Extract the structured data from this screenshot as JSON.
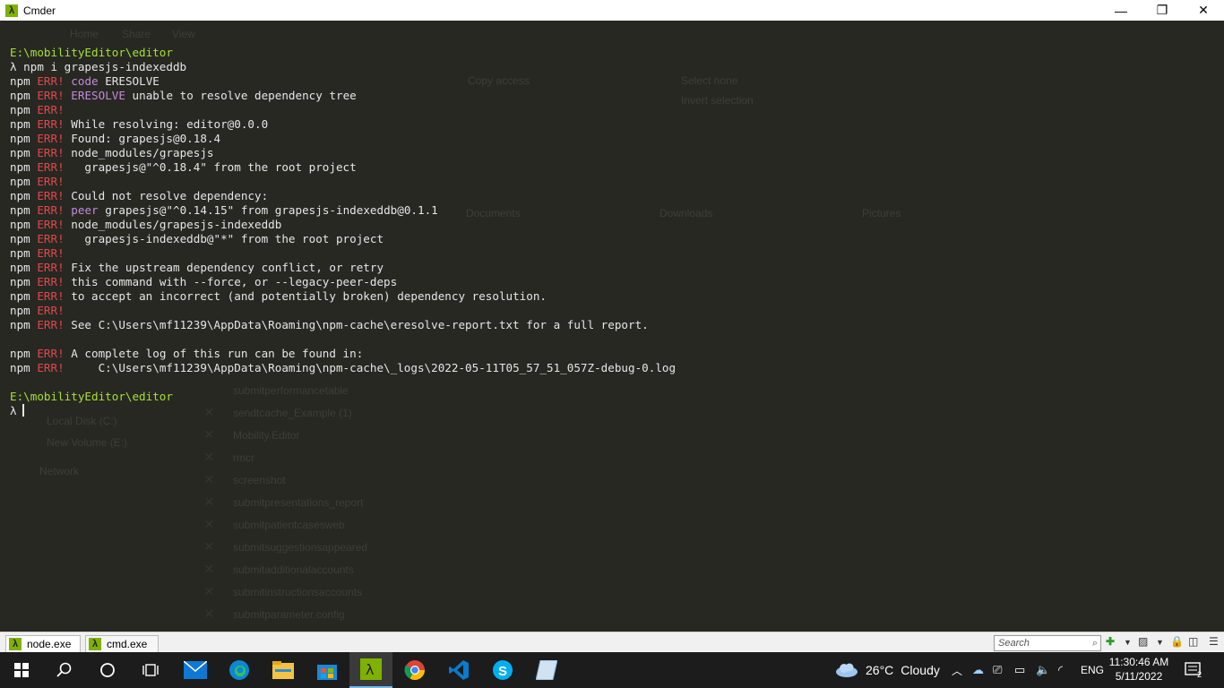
{
  "window": {
    "title": "Cmder",
    "icon": "lambda-icon",
    "minimize": "—",
    "maximize": "❐",
    "close": "✕"
  },
  "terminal": {
    "lines": [
      [
        {
          "t": "E:\\mobilityEditor\\editor",
          "c": "path"
        }
      ],
      [
        {
          "t": "λ npm i grapesjs-indexeddb",
          "c": ""
        }
      ],
      [
        {
          "t": "npm ",
          "c": ""
        },
        {
          "t": "ERR!",
          "c": "err"
        },
        {
          "t": " ",
          "c": ""
        },
        {
          "t": "code",
          "c": "kw"
        },
        {
          "t": " ERESOLVE",
          "c": ""
        }
      ],
      [
        {
          "t": "npm ",
          "c": ""
        },
        {
          "t": "ERR!",
          "c": "err"
        },
        {
          "t": " ",
          "c": ""
        },
        {
          "t": "ERESOLVE",
          "c": "kw"
        },
        {
          "t": " unable to resolve dependency tree",
          "c": ""
        }
      ],
      [
        {
          "t": "npm ",
          "c": ""
        },
        {
          "t": "ERR!",
          "c": "err"
        }
      ],
      [
        {
          "t": "npm ",
          "c": ""
        },
        {
          "t": "ERR!",
          "c": "err"
        },
        {
          "t": " While resolving: editor@0.0.0",
          "c": ""
        }
      ],
      [
        {
          "t": "npm ",
          "c": ""
        },
        {
          "t": "ERR!",
          "c": "err"
        },
        {
          "t": " Found: grapesjs@0.18.4",
          "c": ""
        }
      ],
      [
        {
          "t": "npm ",
          "c": ""
        },
        {
          "t": "ERR!",
          "c": "err"
        },
        {
          "t": " node_modules/grapesjs",
          "c": ""
        }
      ],
      [
        {
          "t": "npm ",
          "c": ""
        },
        {
          "t": "ERR!",
          "c": "err"
        },
        {
          "t": "   grapesjs@\"^0.18.4\" from the root project",
          "c": ""
        }
      ],
      [
        {
          "t": "npm ",
          "c": ""
        },
        {
          "t": "ERR!",
          "c": "err"
        }
      ],
      [
        {
          "t": "npm ",
          "c": ""
        },
        {
          "t": "ERR!",
          "c": "err"
        },
        {
          "t": " Could not resolve dependency:",
          "c": ""
        }
      ],
      [
        {
          "t": "npm ",
          "c": ""
        },
        {
          "t": "ERR!",
          "c": "err"
        },
        {
          "t": " ",
          "c": ""
        },
        {
          "t": "peer",
          "c": "kw"
        },
        {
          "t": " grapesjs@\"^0.14.15\" from grapesjs-indexeddb@0.1.1",
          "c": ""
        }
      ],
      [
        {
          "t": "npm ",
          "c": ""
        },
        {
          "t": "ERR!",
          "c": "err"
        },
        {
          "t": " node_modules/grapesjs-indexeddb",
          "c": ""
        }
      ],
      [
        {
          "t": "npm ",
          "c": ""
        },
        {
          "t": "ERR!",
          "c": "err"
        },
        {
          "t": "   grapesjs-indexeddb@\"*\" from the root project",
          "c": ""
        }
      ],
      [
        {
          "t": "npm ",
          "c": ""
        },
        {
          "t": "ERR!",
          "c": "err"
        }
      ],
      [
        {
          "t": "npm ",
          "c": ""
        },
        {
          "t": "ERR!",
          "c": "err"
        },
        {
          "t": " Fix the upstream dependency conflict, or retry",
          "c": ""
        }
      ],
      [
        {
          "t": "npm ",
          "c": ""
        },
        {
          "t": "ERR!",
          "c": "err"
        },
        {
          "t": " this command with --force, or --legacy-peer-deps",
          "c": ""
        }
      ],
      [
        {
          "t": "npm ",
          "c": ""
        },
        {
          "t": "ERR!",
          "c": "err"
        },
        {
          "t": " to accept an incorrect (and potentially broken) dependency resolution.",
          "c": ""
        }
      ],
      [
        {
          "t": "npm ",
          "c": ""
        },
        {
          "t": "ERR!",
          "c": "err"
        }
      ],
      [
        {
          "t": "npm ",
          "c": ""
        },
        {
          "t": "ERR!",
          "c": "err"
        },
        {
          "t": " See C:\\Users\\mf11239\\AppData\\Roaming\\npm-cache\\eresolve-report.txt for a full report.",
          "c": ""
        }
      ],
      [],
      [
        {
          "t": "npm ",
          "c": ""
        },
        {
          "t": "ERR!",
          "c": "err"
        },
        {
          "t": " A complete log of this run can be found in:",
          "c": ""
        }
      ],
      [
        {
          "t": "npm ",
          "c": ""
        },
        {
          "t": "ERR!",
          "c": "err"
        },
        {
          "t": "     C:\\Users\\mf11239\\AppData\\Roaming\\npm-cache\\_logs\\2022-05-11T05_57_51_057Z-debug-0.log",
          "c": ""
        }
      ],
      [],
      [
        {
          "t": "E:\\mobilityEditor\\editor",
          "c": "path"
        }
      ],
      [
        {
          "t": "λ",
          "c": ""
        }
      ]
    ]
  },
  "background_ghost": {
    "items": [
      "Home",
      "Share",
      "View",
      "Copy access",
      "Select none",
      "Invert selection",
      "Documents",
      "Downloads",
      "Pictures",
      "Local Disk (C:)",
      "New Volume (E:)",
      "Network",
      "submitperformancetable",
      "sendtcache_Example (1)",
      "Mobility.Editor",
      "rmcr",
      "screenshot",
      "submitpresentations_report",
      "submitpatientcasesweb",
      "submitsuggestionsappeared",
      "submitadditionalaccounts",
      "submitinstructionsaccounts",
      "submitparameter.config"
    ]
  },
  "statusbar": {
    "tabs": [
      {
        "label": "node.exe",
        "icon": "lambda-icon"
      },
      {
        "label": "cmd.exe",
        "icon": "lambda-icon"
      }
    ],
    "search_placeholder": "Search",
    "icons": [
      "search-icon",
      "plus-icon",
      "dropdown-icon",
      "chart-icon",
      "panel-icon",
      "menu-icon"
    ]
  },
  "taskbar": {
    "apps": [
      "windows-start-icon",
      "search-icon",
      "cortana-icon",
      "task-view-icon",
      "mail-icon",
      "edge-icon",
      "file-explorer-icon",
      "store-icon",
      "cmder-icon",
      "chrome-icon",
      "vscode-icon",
      "skype-icon",
      "unknown-app-icon"
    ],
    "weather": {
      "temp": "26°C",
      "cond": "Cloudy"
    },
    "tray_icons": [
      "chevron-up-icon",
      "onedrive-icon",
      "network-icon",
      "volume-icon",
      "wifi-icon"
    ],
    "lang": "ENG",
    "time": "11:30:46 AM",
    "date": "5/11/2022",
    "notifications": "2"
  },
  "colors": {
    "bg": "#272822",
    "path": "#a6e22e",
    "err": "#e5464a",
    "kw": "#c48adc"
  }
}
